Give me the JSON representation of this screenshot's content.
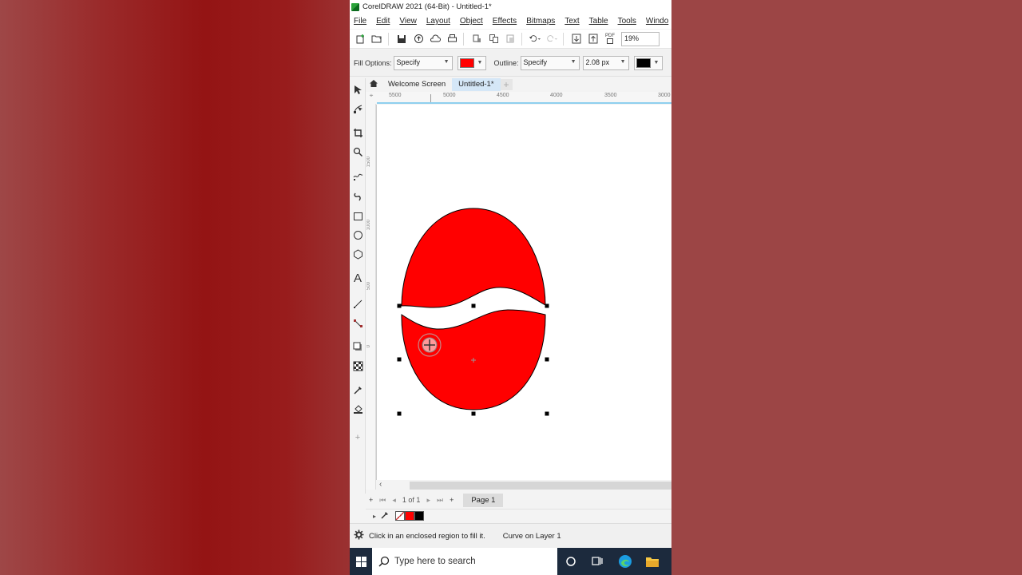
{
  "window": {
    "title": "CorelDRAW 2021 (64-Bit) - Untitled-1*"
  },
  "menu": [
    "File",
    "Edit",
    "View",
    "Layout",
    "Object",
    "Effects",
    "Bitmaps",
    "Text",
    "Table",
    "Tools",
    "Windo"
  ],
  "toolbar": {
    "icons": [
      "new-document-icon",
      "open-icon",
      "save-icon",
      "upload-icon",
      "cloud-icon",
      "print-icon",
      "cut-icon",
      "copy-icon",
      "paste-icon",
      "undo-icon",
      "redo-icon",
      "import-icon",
      "export-icon",
      "pdf-icon"
    ],
    "pdf_label": "PDF",
    "zoom": "19%"
  },
  "property_bar": {
    "fill_label": "Fill Options:",
    "fill_value": "Specify",
    "fill_color": "#ff0000",
    "outline_label": "Outline:",
    "outline_value": "Specify",
    "outline_width": "2.08 px",
    "outline_color": "#000000"
  },
  "tabs": {
    "home": "home-icon",
    "items": [
      "Welcome Screen",
      "Untitled-1*"
    ],
    "add": "+"
  },
  "ruler": {
    "h_ticks": [
      "5500",
      "5000",
      "4500",
      "4000",
      "3500",
      "3000"
    ],
    "v_ticks": [
      "1500",
      "1000",
      "500",
      "0"
    ]
  },
  "drawing": {
    "shape_fill": "#ff0000",
    "outline": "#000000",
    "selection": "Curve on Layer 1"
  },
  "page_nav": {
    "counter": "1 of 1",
    "add": "+",
    "page_tab": "Page 1"
  },
  "palette": {
    "colors": [
      "#ffffff",
      "#ff0000",
      "#000000"
    ]
  },
  "status": {
    "hint": "Click in an enclosed region to fill it.",
    "selection": "Curve on Layer 1"
  },
  "taskbar": {
    "search_placeholder": "Type here to search"
  }
}
